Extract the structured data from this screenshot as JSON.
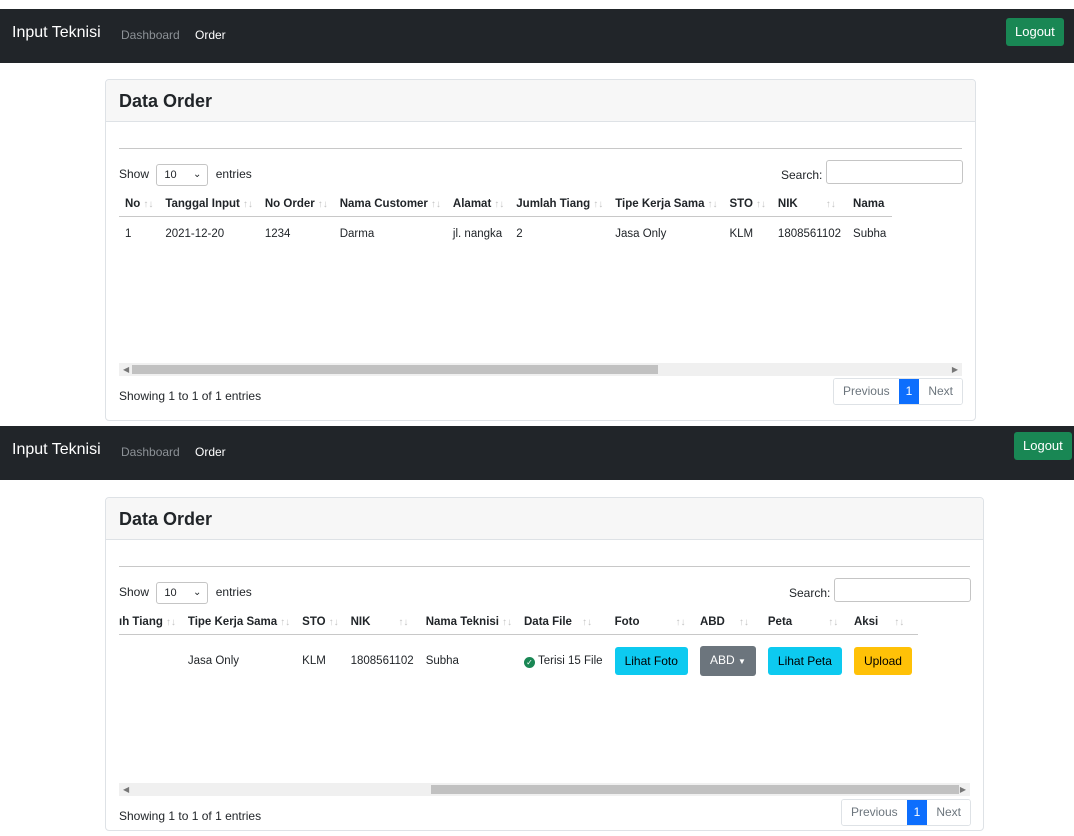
{
  "navbar": {
    "brand": "Input Teknisi",
    "links": [
      "Dashboard",
      "Order"
    ],
    "logout_label": "Logout"
  },
  "card": {
    "title": "Data Order",
    "length_show": "Show",
    "length_value": "10",
    "length_entries": "entries",
    "search_label": "Search:",
    "info": "Showing 1 to 1 of 1 entries",
    "pager": [
      "Previous",
      "1",
      "Next"
    ]
  },
  "table": {
    "columns": [
      "No",
      "Tanggal Input",
      "No Order",
      "Nama Customer",
      "Alamat",
      "Jumlah Tiang",
      "Tipe Kerja Sama",
      "STO",
      "NIK",
      "Nama Teknisi",
      "Data File",
      "Foto",
      "ABD",
      "Peta",
      "Aksi"
    ],
    "row": {
      "no": "1",
      "tanggal": "2021-12-20",
      "order": "1234",
      "customer": "Darma",
      "alamat": "jl. nangka",
      "tiang": "2",
      "tipe": "Jasa Only",
      "sto": "KLM",
      "nik": "1808561102",
      "teknisi": "Subha",
      "datafile": "Terisi 15 File",
      "foto_btn": "Lihat Foto",
      "abd_btn": "ABD",
      "peta_btn": "Lihat Peta",
      "aksi_btn": "Upload"
    },
    "truncated": {
      "nama_header": "Nama",
      "nama_cell": "Subha",
      "tiang_header": "ıh Tiang"
    }
  },
  "icons": [
    "chevron-down-icon",
    "sort-icon",
    "check-circle-icon",
    "caret-down-icon",
    "scroll-left-icon",
    "scroll-right-icon"
  ],
  "colors": {
    "navbar": "#212529",
    "logout": "#198754",
    "primary": "#0d6efd",
    "info": "#0dcaf0",
    "secondary": "#6c757d",
    "warning": "#ffc107",
    "success": "#198754"
  }
}
